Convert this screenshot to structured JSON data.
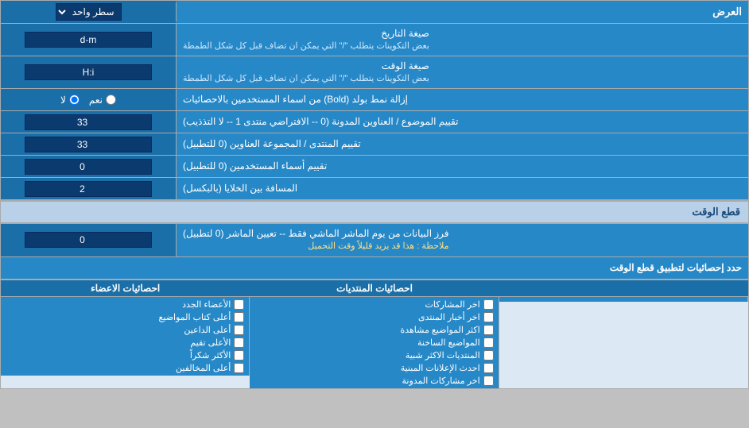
{
  "page": {
    "title": "العرض",
    "header_select_label": "سطر واحد",
    "sections": {
      "date_format": {
        "label": "صيغة التاريخ",
        "sublabel": "بعض التكوينات يتطلب \"/\" التي يمكن ان تضاف قبل كل شكل الطمطة",
        "value": "d-m"
      },
      "time_format": {
        "label": "صيغة الوقت",
        "sublabel": "بعض التكوينات يتطلب \"/\" التي يمكن ان تضاف قبل كل شكل الطمطة",
        "value": "H:i"
      },
      "bold_remove": {
        "label": "إزالة نمط بولد (Bold) من اسماء المستخدمين بالاحصائيات",
        "radio_yes": "نعم",
        "radio_no": "لا",
        "selected": "no"
      },
      "topic_order": {
        "label": "تقييم الموضوع / العناوين المدونة (0 -- الافتراضي منتدى 1 -- لا التذذيب)",
        "value": "33"
      },
      "forum_order": {
        "label": "تقييم المنتدى / المجموعة العناوين (0 للتطبيل)",
        "value": "33"
      },
      "user_names": {
        "label": "تقييم أسماء المستخدمين (0 للتطبيل)",
        "value": "0"
      },
      "cell_spacing": {
        "label": "المسافة بين الخلايا (بالبكسل)",
        "value": "2"
      }
    },
    "cutoff_section": {
      "title": "قطع الوقت",
      "fetch_label": "فرز البيانات من يوم الماشر الماشي فقط -- تعيين الماشر (0 لتطبيل)",
      "note": "ملاحظة : هذا قد يزيد قليلاً وقت التحميل",
      "fetch_value": "0"
    },
    "stats_apply": {
      "label": "حدد إحصائيات لتطبيق قطع الوقت"
    },
    "post_stats": {
      "header": "احصائيات المنتديات",
      "items": [
        "اخر المشاركات",
        "اخر أخبار المنتدى",
        "اكثر المواضيع مشاهدة",
        "المواضيع الساخنة",
        "المنتديات الاكثر شبية",
        "احدث الإعلانات المبنية",
        "اخر مشاركات المدونة"
      ]
    },
    "member_stats": {
      "header": "احصائيات الاعضاء",
      "items": [
        "الأعضاء الجدد",
        "أعلى كتاب المواضيع",
        "أعلى الداعين",
        "الأعلى تقيم",
        "الأكثر شكراً",
        "أعلى المخالفين"
      ]
    },
    "empty_col": {
      "header": "",
      "items": []
    }
  }
}
